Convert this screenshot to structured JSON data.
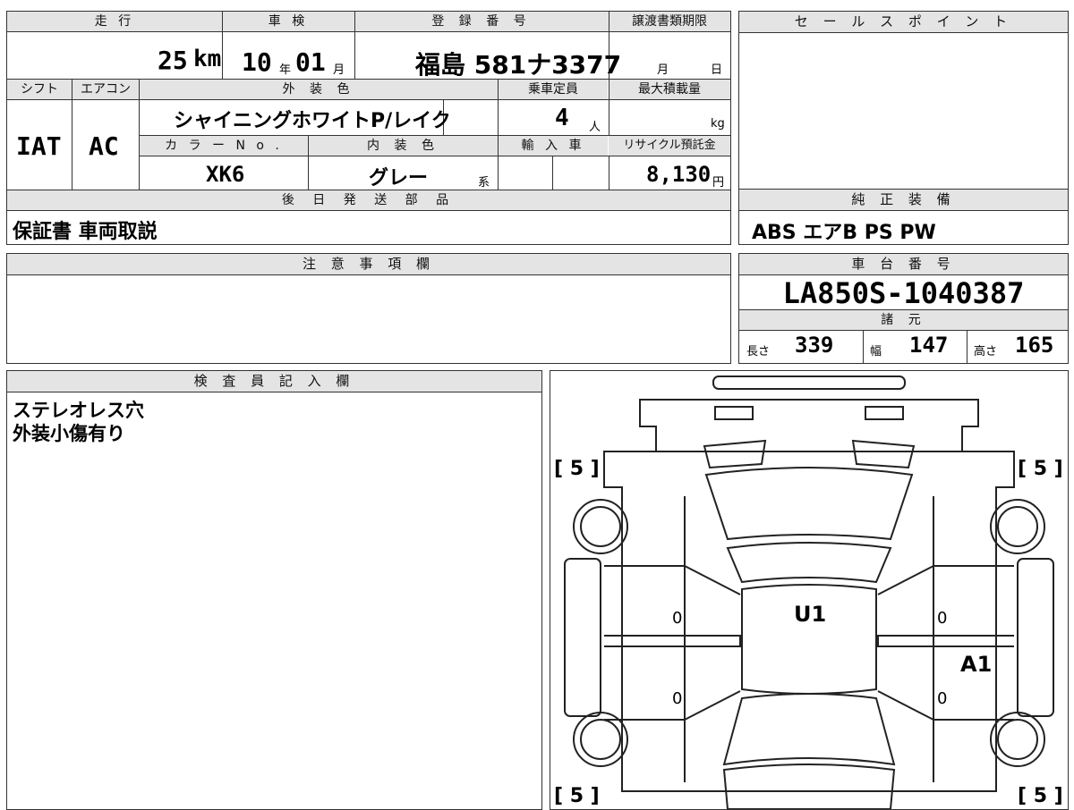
{
  "spec": {
    "labels": {
      "mileage": "走 行",
      "inspection": "車 検",
      "registration": "登 録 番 号",
      "transfer_deadline": "譲渡書類期限",
      "shift": "シフト",
      "aircon": "エアコン",
      "exterior_color": "外 装 色",
      "capacity": "乗車定員",
      "max_load": "最大積載量",
      "color_no": "カ ラ ー N o .",
      "interior_color": "内 装 色",
      "import": "輸 入 車",
      "recycle": "リサイクル預託金",
      "deferred_parts": "後 日 発 送 部 品"
    },
    "mileage_value": "25",
    "mileage_unit": "km",
    "inspection_year": "10",
    "year_unit": "年",
    "inspection_month": "01",
    "month_unit": "月",
    "registration_number": "福島 581ナ3377",
    "transfer_month_unit": "月",
    "transfer_day_unit": "日",
    "shift_value": "IAT",
    "aircon_value": "AC",
    "exterior_color_value": "シャイニングホワイトP/レイク",
    "capacity_value": "4",
    "capacity_unit": "人",
    "max_load_unit": "kg",
    "color_no_value": "XK6",
    "interior_color_value": "グレー",
    "interior_color_suffix": "系",
    "recycle_value": "8,130",
    "recycle_unit": "円",
    "deferred_parts_value": "保証書 車両取説"
  },
  "sales_point": {
    "title": "セ ー ル ス ポ イ ン ト"
  },
  "equipment": {
    "title": "純 正 装 備",
    "value": "ABS エアB PS PW"
  },
  "notes": {
    "title": "注 意 事 項 欄"
  },
  "chassis": {
    "title": "車 台 番 号",
    "value": "LA850S-1040387",
    "specs_title": "諸 元",
    "length_label": "長さ",
    "length_value": "339",
    "width_label": "幅",
    "width_value": "147",
    "height_label": "高さ",
    "height_value": "165"
  },
  "inspector": {
    "title": "検 査 員 記 入 欄",
    "line1": "ステレオレス穴",
    "line2": "外装小傷有り"
  },
  "diagram": {
    "tire_front_left": "[ 5 ]",
    "tire_front_right": "[ 5 ]",
    "tire_rear_left": "[ 5 ]",
    "tire_rear_right": "[ 5 ]",
    "mark_roof": "U1",
    "mark_right_door": "A1",
    "zero_1": "0",
    "zero_2": "0",
    "zero_3": "0",
    "zero_4": "0"
  }
}
